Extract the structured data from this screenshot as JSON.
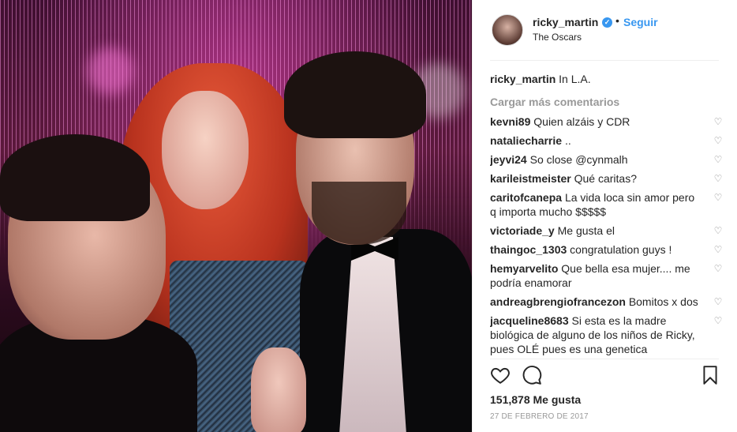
{
  "post": {
    "username": "ricky_martin",
    "follow_label": "Seguir",
    "location": "The Oscars",
    "caption_user": "ricky_martin",
    "caption_text": "In L.A.",
    "load_more": "Cargar más comentarios",
    "likes": "151,878 Me gusta",
    "date": "27 DE FEBRERO DE 2017"
  },
  "comments": [
    {
      "user": "kevni89",
      "text": "Quien alzáis y CDR"
    },
    {
      "user": "nataliecharrie",
      "text": ".."
    },
    {
      "user": "jeyvi24",
      "text": "So close @cynmalh"
    },
    {
      "user": "karileistmeister",
      "text": "Qué caritas?"
    },
    {
      "user": "caritofcanepa",
      "text": "La vida loca sin amor pero q importa mucho $$$$$"
    },
    {
      "user": "victoriade_y",
      "text": "Me gusta el"
    },
    {
      "user": "thaingoc_1303",
      "text": "congratulation guys !"
    },
    {
      "user": "hemyarvelito",
      "text": "Que bella esa mujer.... me podría enamorar"
    },
    {
      "user": "andreagbrengiofrancezon",
      "text": "Bomitos x dos"
    },
    {
      "user": "jacqueline8683",
      "text": "Si esta es la madre biológica de alguno de los niños de Ricky, pues OLÉ pues es una genetica"
    }
  ],
  "icons": {
    "verified": "verified-badge-icon",
    "like": "heart-icon",
    "comment": "comment-bubble-icon",
    "save": "bookmark-icon"
  },
  "colors": {
    "link_blue": "#3897f0",
    "muted": "#999999",
    "text": "#262626"
  }
}
